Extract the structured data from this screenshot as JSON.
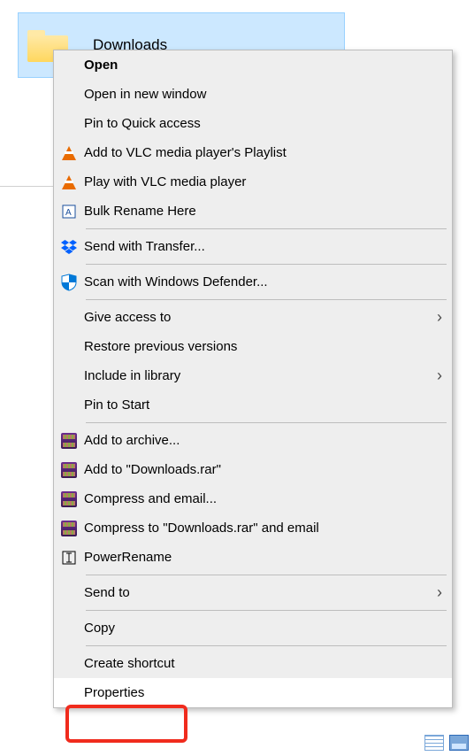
{
  "folder": {
    "name": "Downloads"
  },
  "menu": {
    "open": "Open",
    "open_new_window": "Open in new window",
    "pin_quick_access": "Pin to Quick access",
    "add_vlc_playlist": "Add to VLC media player's Playlist",
    "play_vlc": "Play with VLC media player",
    "bulk_rename": "Bulk Rename Here",
    "send_transfer": "Send with Transfer...",
    "scan_defender": "Scan with Windows Defender...",
    "give_access_to": "Give access to",
    "restore_prev": "Restore previous versions",
    "include_library": "Include in library",
    "pin_start": "Pin to Start",
    "add_archive": "Add to archive...",
    "add_downloads_rar": "Add to \"Downloads.rar\"",
    "compress_email": "Compress and email...",
    "compress_downloads_email": "Compress to \"Downloads.rar\" and email",
    "power_rename": "PowerRename",
    "send_to": "Send to",
    "copy": "Copy",
    "create_shortcut": "Create shortcut",
    "properties": "Properties"
  }
}
